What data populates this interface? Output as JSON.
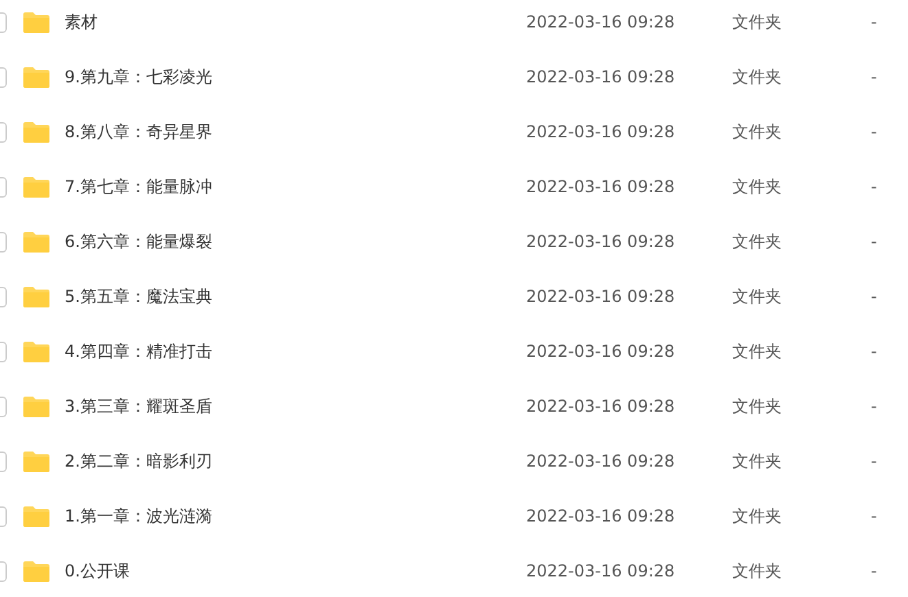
{
  "files": [
    {
      "name": "素材",
      "modified": "2022-03-16 09:28",
      "type": "文件夹",
      "size": "-",
      "checked": false
    },
    {
      "name": "9.第九章：七彩凌光",
      "modified": "2022-03-16 09:28",
      "type": "文件夹",
      "size": "-",
      "checked": false
    },
    {
      "name": "8.第八章：奇异星界",
      "modified": "2022-03-16 09:28",
      "type": "文件夹",
      "size": "-",
      "checked": false
    },
    {
      "name": "7.第七章：能量脉冲",
      "modified": "2022-03-16 09:28",
      "type": "文件夹",
      "size": "-",
      "checked": false
    },
    {
      "name": "6.第六章：能量爆裂",
      "modified": "2022-03-16 09:28",
      "type": "文件夹",
      "size": "-",
      "checked": false
    },
    {
      "name": "5.第五章：魔法宝典",
      "modified": "2022-03-16 09:28",
      "type": "文件夹",
      "size": "-",
      "checked": false
    },
    {
      "name": "4.第四章：精准打击",
      "modified": "2022-03-16 09:28",
      "type": "文件夹",
      "size": "-",
      "checked": false
    },
    {
      "name": "3.第三章：耀斑圣盾",
      "modified": "2022-03-16 09:28",
      "type": "文件夹",
      "size": "-",
      "checked": false
    },
    {
      "name": "2.第二章：暗影利刃",
      "modified": "2022-03-16 09:28",
      "type": "文件夹",
      "size": "-",
      "checked": false
    },
    {
      "name": "1.第一章：波光涟漪",
      "modified": "2022-03-16 09:28",
      "type": "文件夹",
      "size": "-",
      "checked": false
    },
    {
      "name": "0.公开课",
      "modified": "2022-03-16 09:28",
      "type": "文件夹",
      "size": "-",
      "checked": false
    }
  ]
}
